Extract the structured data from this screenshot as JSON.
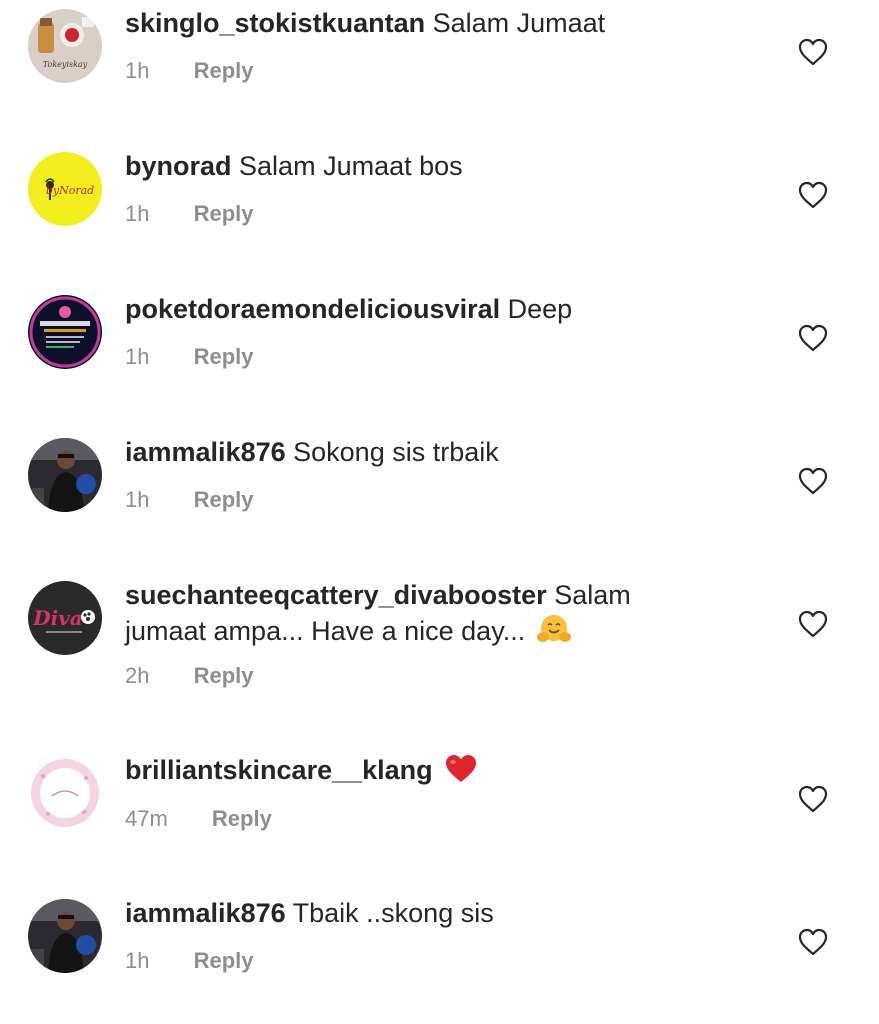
{
  "comments": [
    {
      "username": "skinglo_stokistkuantan",
      "text": "Salam Jumaat",
      "time": "1h",
      "reply_label": "Reply",
      "avatar": "skinglo-avatar"
    },
    {
      "username": "bynorad",
      "text": "Salam Jumaat bos",
      "time": "1h",
      "reply_label": "Reply",
      "avatar": "bynorad-avatar"
    },
    {
      "username": "poketdoraemondeliciousviral",
      "text": "Deep",
      "time": "1h",
      "reply_label": "Reply",
      "avatar": "poketdoraemon-avatar"
    },
    {
      "username": "iammalik876",
      "text": "Sokong sis trbaik",
      "time": "1h",
      "reply_label": "Reply",
      "avatar": "iammalik-avatar"
    },
    {
      "username": "suechanteeqcattery_divabooster",
      "text": "Salam jumaat ampa... Have a nice day...",
      "emoji": "hugging-face-emoji",
      "time": "2h",
      "reply_label": "Reply",
      "avatar": "diva-avatar"
    },
    {
      "username": "brilliantskincare__klang",
      "text": "",
      "emoji": "red-heart-emoji",
      "time": "47m",
      "reply_label": "Reply",
      "avatar": "brilliant-avatar"
    },
    {
      "username": "iammalik876",
      "text": "Tbaik ..skong sis",
      "time": "1h",
      "reply_label": "Reply",
      "avatar": "iammalik-avatar"
    }
  ],
  "avatar_labels": {
    "skinglo": "Tokeyiskay",
    "bynorad": "byNorad",
    "diva": "Diva"
  },
  "colors": {
    "text": "#262626",
    "meta": "#8e8e8e",
    "bynorad_bg": "#f5ee1e",
    "diva_pink": "#d6336c",
    "heart_red": "#e0252e"
  }
}
